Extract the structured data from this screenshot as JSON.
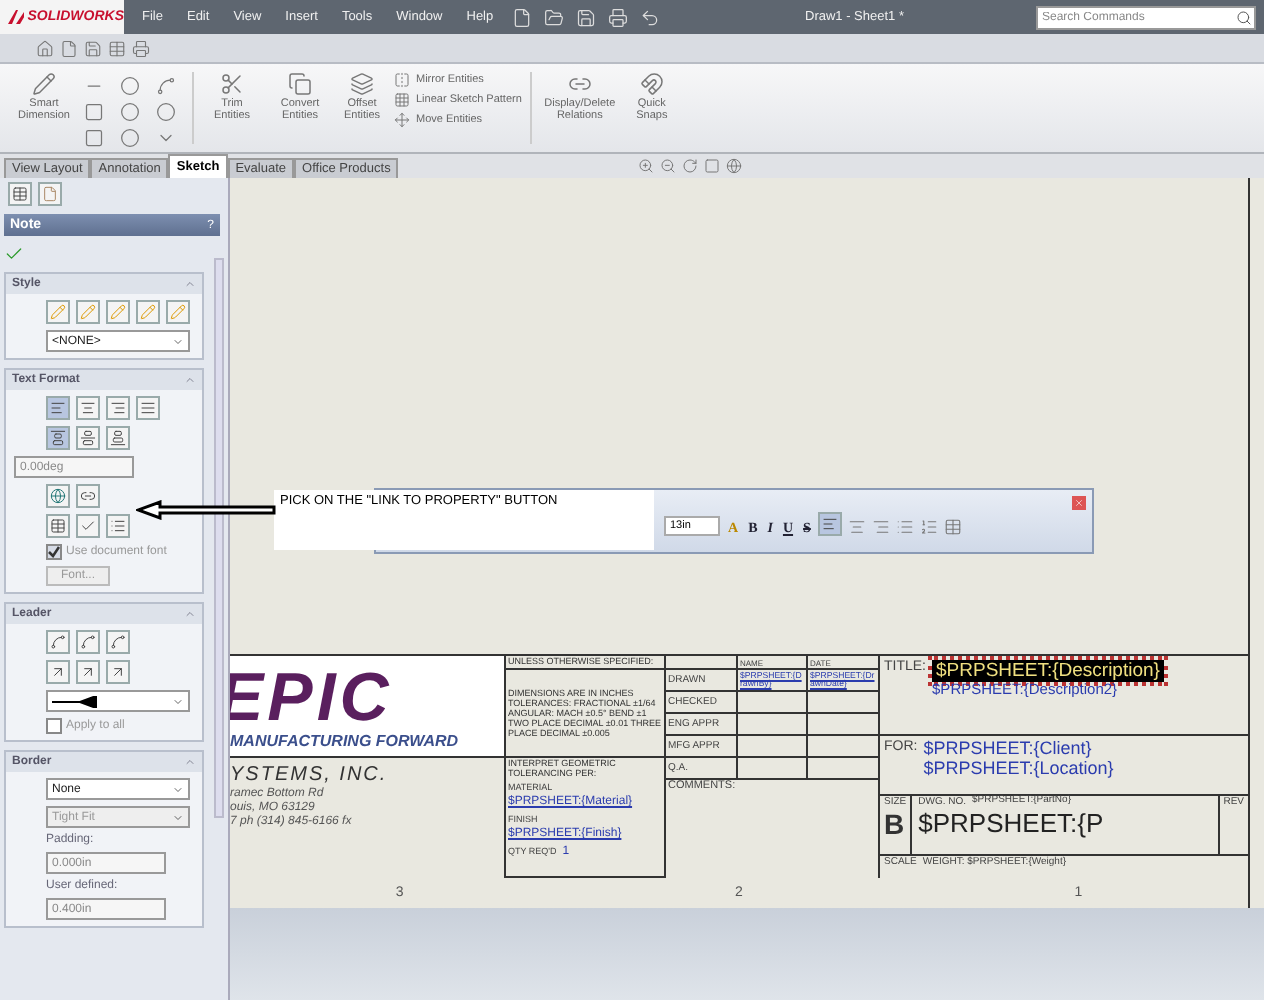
{
  "app": {
    "logo": "SOLIDWORKS",
    "menu": [
      "File",
      "Edit",
      "View",
      "Insert",
      "Tools",
      "Window",
      "Help"
    ],
    "document_title": "Draw1 - Sheet1 *",
    "search": {
      "placeholder": "Search Commands"
    }
  },
  "ribbon": {
    "big_buttons": [
      "Smart Dimension",
      "Trim Entities",
      "Convert Entities",
      "Offset Entities",
      "Display/Delete Relations",
      "Quick Snaps"
    ],
    "list_buttons": [
      "Mirror Entities",
      "Linear Sketch Pattern",
      "Move Entities"
    ]
  },
  "tabs": [
    {
      "label": "View Layout",
      "selected": false
    },
    {
      "label": "Annotation",
      "selected": false
    },
    {
      "label": "Sketch",
      "selected": true
    },
    {
      "label": "Evaluate",
      "selected": false
    },
    {
      "label": "Office Products",
      "selected": false
    }
  ],
  "property_manager": {
    "title": "Note",
    "help": "?",
    "style": {
      "title": "Style",
      "value": "<NONE>"
    },
    "text_format": {
      "title": "Text Format",
      "angle": "0.00deg",
      "use_document_font": {
        "label": "Use document font",
        "checked": true,
        "disabled": true
      },
      "font_button": "Font..."
    },
    "leader": {
      "title": "Leader",
      "apply_to_all": {
        "label": "Apply to all",
        "checked": false,
        "disabled": true
      }
    },
    "border": {
      "title": "Border",
      "style": "None",
      "size": "Tight Fit",
      "padding_label": "Padding:",
      "padding": "0.000in",
      "user_defined_label": "User defined:",
      "user_defined": "0.400in"
    }
  },
  "callout": "PICK ON THE \"LINK TO PROPERTY\" BUTTON",
  "format_toolbar": {
    "size": "13in",
    "buttons": [
      "A",
      "B",
      "I",
      "U",
      "S"
    ]
  },
  "title_block": {
    "logo": "EPIC",
    "tagline": "MANUFACTURING FORWARD",
    "company": "YSTEMS, INC.",
    "address": [
      "ramec Bottom Rd",
      "ouis, MO 63129",
      "7 ph (314) 845-6166 fx"
    ],
    "unless": "UNLESS OTHERWISE SPECIFIED:",
    "tolerances": "DIMENSIONS ARE IN INCHES TOLERANCES: FRACTIONAL ±1/64 ANGULAR: MACH ±0.5° BEND ±1 TWO PLACE DECIMAL ±0.01 THREE PLACE DECIMAL ±0.005",
    "interpret": "INTERPRET GEOMETRIC TOLERANCING PER:",
    "material_label": "MATERIAL",
    "material": "$PRPSHEET:{Material}",
    "finish_label": "FINISH",
    "finish": "$PRPSHEET:{Finish}",
    "qty_label": "QTY REQ'D",
    "qty": "1",
    "name_header": "NAME",
    "date_header": "DATE",
    "approvals": [
      {
        "label": "DRAWN",
        "name": "$PRPSHEET:{DrawnBy}",
        "date": "$PRPSHEET:{DrawnDate}"
      },
      {
        "label": "CHECKED"
      },
      {
        "label": "ENG APPR"
      },
      {
        "label": "MFG APPR"
      },
      {
        "label": "Q.A."
      }
    ],
    "comments": "COMMENTS:",
    "title_label": "TITLE:",
    "title": "$PRPSHEET:{Description}",
    "title2": "$PRPSHEET:{Description2}",
    "for_label": "FOR:",
    "client": "$PRPSHEET:{Client}",
    "location": "$PRPSHEET:{Location}",
    "size_label": "SIZE",
    "size": "B",
    "dwg_label": "DWG. NO.",
    "dwg_small": "$PRPSHEET:{PartNo}",
    "dwg_big": "$PRPSHEET:{P",
    "rev_label": "REV",
    "scale_label": "SCALE",
    "weight": "WEIGHT: $PRPSHEET:{Weight}"
  },
  "zones": [
    "3",
    "2",
    "1"
  ]
}
